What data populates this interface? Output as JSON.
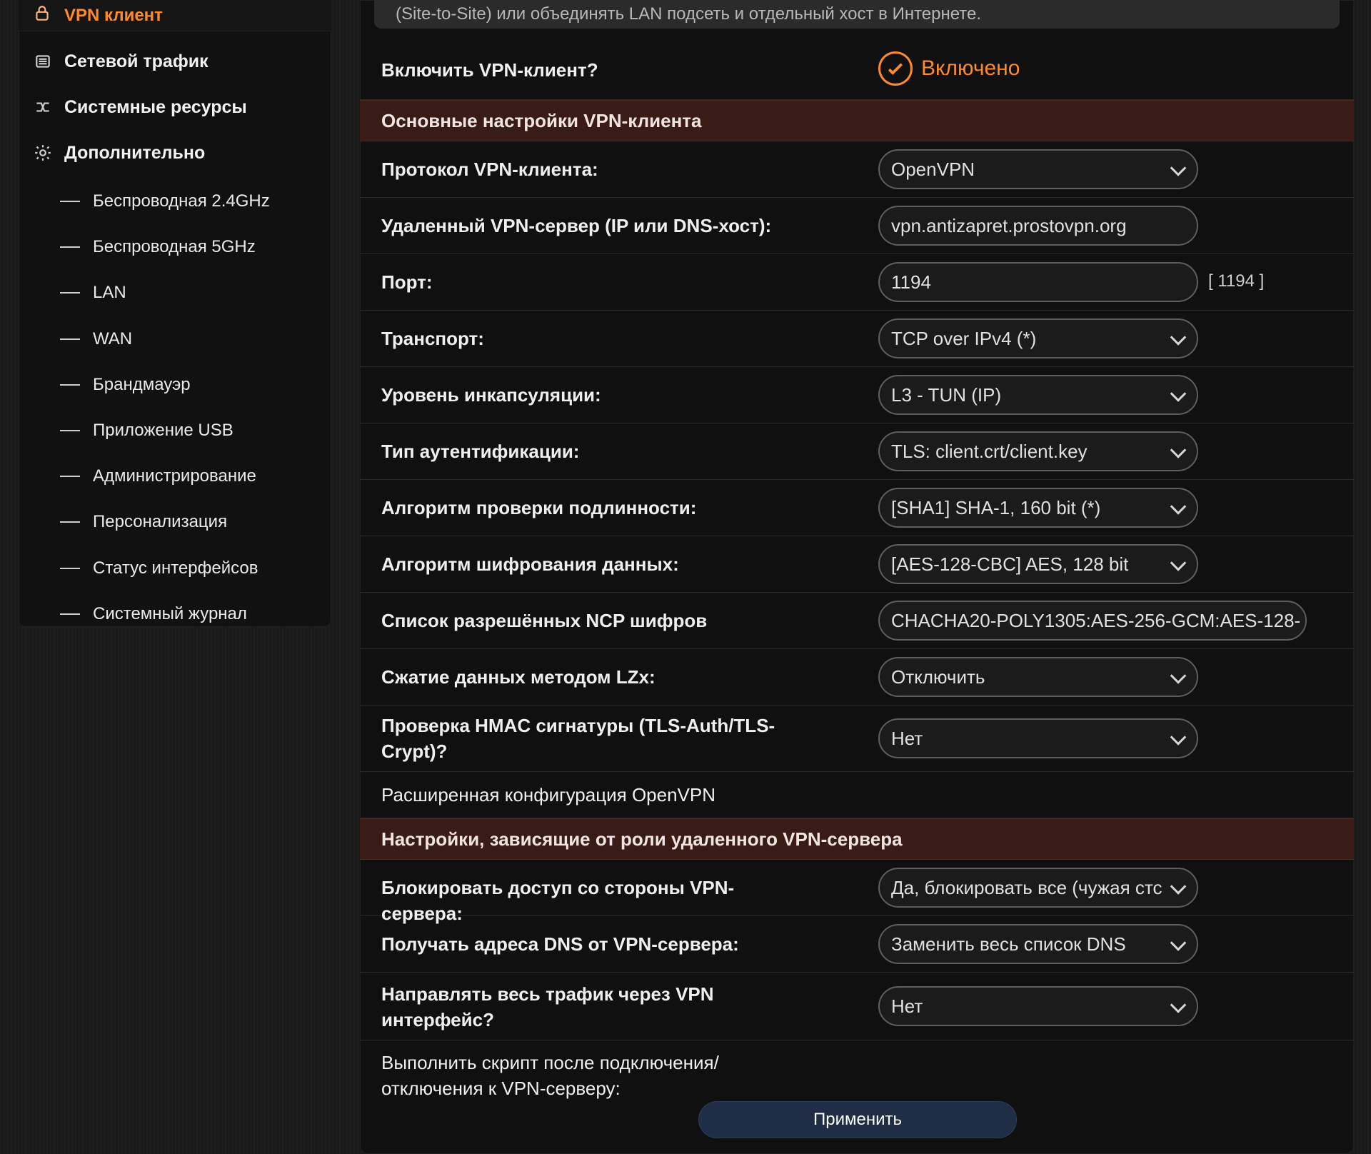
{
  "sidebar": {
    "active": {
      "label": "VPN клиент",
      "icon": "lock-icon"
    },
    "items": [
      {
        "label": "Сетевой трафик",
        "icon": "list-icon"
      },
      {
        "label": "Системные ресурсы",
        "icon": "shuffle-icon"
      },
      {
        "label": "Дополнительно",
        "icon": "gear-icon"
      }
    ],
    "subitems": [
      "Беспроводная 2.4GHz",
      "Беспроводная 5GHz",
      "LAN",
      "WAN",
      "Брандмауэр",
      "Приложение USB",
      "Администрирование",
      "Персонализация",
      "Статус интерфейсов",
      "Системный журнал"
    ]
  },
  "content": {
    "intro": "(Site-to-Site) или объединять LAN подсеть и отдельный хост в Интернете.",
    "enable": {
      "label": "Включить VPN-клиент?",
      "value": "Включено"
    },
    "section1": "Основные настройки VPN-клиента",
    "fields1": [
      {
        "label": "Протокол VPN-клиента:",
        "type": "select",
        "value": "OpenVPN"
      },
      {
        "label": "Удаленный VPN-сервер (IP или DNS-хост):",
        "type": "input",
        "value": "vpn.antizapret.prostovpn.org"
      },
      {
        "label": "Порт:",
        "type": "input",
        "value": "1194",
        "hint": "[ 1194 ]"
      },
      {
        "label": "Транспорт:",
        "type": "select",
        "value": "TCP over IPv4 (*)"
      },
      {
        "label": "Уровень инкапсуляции:",
        "type": "select",
        "value": "L3 - TUN (IP)"
      },
      {
        "label": "Тип аутентификации:",
        "type": "select",
        "value": "TLS: client.crt/client.key"
      },
      {
        "label": "Алгоритм проверки подлинности:",
        "type": "select",
        "value": "[SHA1] SHA-1, 160 bit (*)"
      },
      {
        "label": "Алгоритм шифрования данных:",
        "type": "select",
        "value": "[AES-128-CBC] AES, 128 bit"
      },
      {
        "label": "Список разрешённых NCP шифров",
        "type": "input",
        "value": "CHACHA20-POLY1305:AES-256-GCM:AES-128-"
      },
      {
        "label": "Сжатие данных методом LZx:",
        "type": "select",
        "value": "Отключить"
      },
      {
        "label": "Проверка HMAC сигнатуры (TLS-Auth/TLS-Crypt)?",
        "type": "select",
        "value": "Нет"
      },
      {
        "label": "Расширенная конфигурация OpenVPN"
      }
    ],
    "section2": "Настройки, зависящие от роли удаленного VPN-сервера",
    "fields2": [
      {
        "label": "Блокировать доступ со стороны VPN-сервера:",
        "type": "select",
        "value": "Да, блокировать все (чужая стс"
      },
      {
        "label": "Получать адреса DNS от VPN-сервера:",
        "type": "select",
        "value": "Заменить весь список DNS"
      },
      {
        "label": "Направлять весь трафик через VPN интерфейс?",
        "type": "select",
        "value": "Нет"
      },
      {
        "label": "Выполнить скрипт после подключения/отключения к VPN-серверу:"
      }
    ],
    "apply": "Применить"
  },
  "colors": {
    "accent": "#ff8a2b",
    "section": "#3a1c17",
    "button": "#1f2d46"
  }
}
